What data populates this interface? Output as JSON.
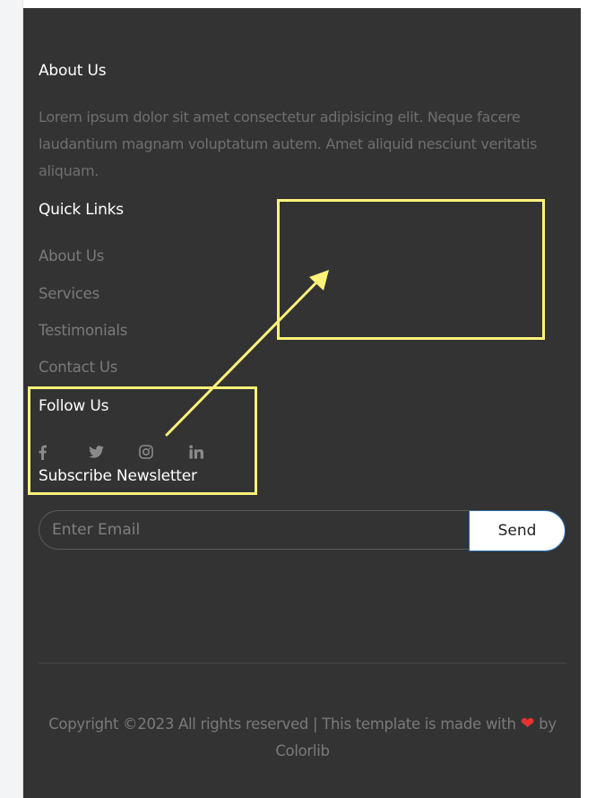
{
  "about": {
    "heading": "About Us",
    "text": "Lorem ipsum dolor sit amet consectetur adipisicing elit. Neque facere laudantium magnam voluptatum autem. Amet aliquid nesciunt veritatis aliquam."
  },
  "quick_links": {
    "heading": "Quick Links",
    "items": [
      {
        "label": "About Us"
      },
      {
        "label": "Services"
      },
      {
        "label": "Testimonials"
      },
      {
        "label": "Contact Us"
      }
    ]
  },
  "follow": {
    "heading": "Follow Us",
    "icons": [
      "facebook-icon",
      "twitter-icon",
      "instagram-icon",
      "linkedin-icon"
    ]
  },
  "newsletter": {
    "heading": "Subscribe Newsletter",
    "placeholder": "Enter Email",
    "button_label": "Send"
  },
  "footer": {
    "copyright_prefix": "Copyright ©2023 All rights reserved | This template is made with",
    "heart_icon": "heart-icon",
    "copyright_by": "by",
    "credit_link": "Colorlib"
  },
  "colors": {
    "footer_bg": "#333333",
    "annotation": "#fff27a",
    "heart": "#e3342f",
    "button_border": "#2d6db5"
  }
}
